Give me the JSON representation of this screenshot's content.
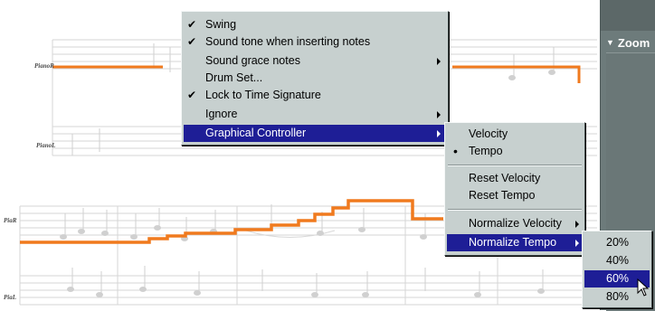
{
  "staff_labels": [
    "PianoR",
    "PianoL",
    "PiaR",
    "PiaL"
  ],
  "side_panel": {
    "zoom_title": "Zoom",
    "expand_icon": "triangle-down-icon"
  },
  "controller_color": "#f07a1e",
  "highlight_color": "#1e1e96",
  "menu1": {
    "items": [
      {
        "label": "Swing",
        "checked": true
      },
      {
        "label": "Sound tone when inserting notes",
        "checked": true
      },
      {
        "label": "Sound grace notes",
        "submenu": true
      },
      {
        "label": "Drum Set..."
      },
      {
        "label": "Lock to Time Signature",
        "checked": true
      },
      {
        "label": "Ignore",
        "submenu": true
      },
      {
        "label": "Graphical Controller",
        "submenu": true,
        "highlighted": true
      }
    ]
  },
  "menu2": {
    "items": [
      {
        "label": "Velocity"
      },
      {
        "label": "Tempo",
        "selected": true
      },
      {
        "label": "Reset Velocity"
      },
      {
        "label": "Reset Tempo"
      },
      {
        "label": "Normalize Velocity",
        "submenu": true
      },
      {
        "label": "Normalize Tempo",
        "submenu": true,
        "highlighted": true
      }
    ]
  },
  "menu3": {
    "items": [
      {
        "label": "20%"
      },
      {
        "label": "40%"
      },
      {
        "label": "60%",
        "highlighted": true
      },
      {
        "label": "80%"
      }
    ]
  }
}
